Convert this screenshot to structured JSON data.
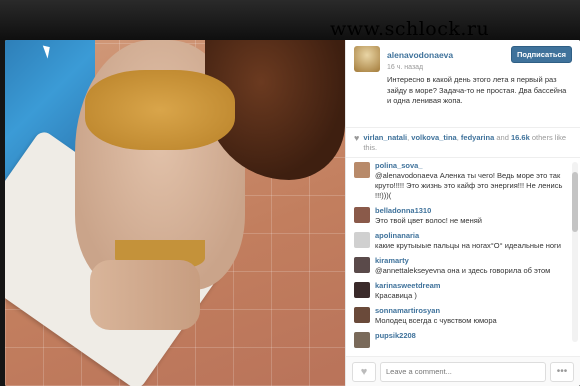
{
  "watermark": "www.schlock.ru",
  "post": {
    "username": "alenavodonaeva",
    "follow_label": "Подписаться",
    "time": "16 ч. назад",
    "caption": "Интересно в какой день этого лета я первый раз зайду в море? Задача-то не простая. Два бассейна и одна ленивая жопа."
  },
  "likes": {
    "users": [
      "virlan_natali",
      "volkova_tina",
      "fedyarina"
    ],
    "and": "and",
    "count": "16.6k",
    "suffix": "others like this."
  },
  "comments": [
    {
      "user": "polina_sova_",
      "text": "@alenavodonaeva Аленка ты чего! Ведь море это так круто!!!!! Это жизнь это кайф это энергия!!! Не ленись !!!)))("
    },
    {
      "user": "belladonna1310",
      "text": "Это твой цвет волос! не меняй"
    },
    {
      "user": "apolinanaria",
      "text": "какие крутыыые пальцы на ногах°O° идеальные ноги"
    },
    {
      "user": "kiramarty",
      "text": "@annettalekseyevna она и здесь говорила об этом"
    },
    {
      "user": "karinasweetdream",
      "text": "Красавица )"
    },
    {
      "user": "sonnamartirosyan",
      "text": "Молодец     всегда с чувством юмора"
    },
    {
      "user": "pupsik2208",
      "text": ""
    }
  ],
  "comment_input": {
    "placeholder": "Leave a comment..."
  },
  "icons": {
    "like": "heart-icon",
    "more": "ellipsis-icon"
  },
  "colors": {
    "accent": "#3f729b"
  }
}
